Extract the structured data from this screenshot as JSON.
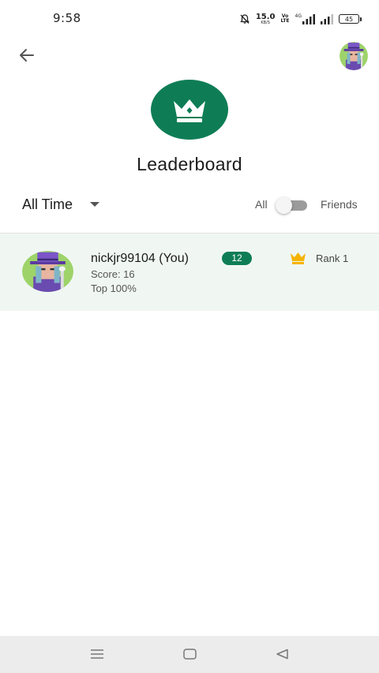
{
  "status_bar": {
    "time": "9:58",
    "net_speed_value": "15.0",
    "net_speed_unit": "KB/S",
    "volte_top": "Vo",
    "volte_bottom": "LTE",
    "network_type": "4G",
    "battery_level": "45"
  },
  "header": {
    "title": "Leaderboard",
    "icon": "crown-icon",
    "accent_color": "#0e7d56"
  },
  "filters": {
    "period": "All Time",
    "scope_left": "All",
    "scope_right": "Friends",
    "friends_only": false
  },
  "entries": [
    {
      "username": "nickjr99104 (You)",
      "level": "12",
      "score": "Score: 16",
      "percentile": "Top 100%",
      "rank": "Rank 1",
      "rank_icon": "gold-crown-icon"
    }
  ],
  "colors": {
    "row_highlight": "#f0f7f3",
    "crown_gold": "#f5b400"
  }
}
